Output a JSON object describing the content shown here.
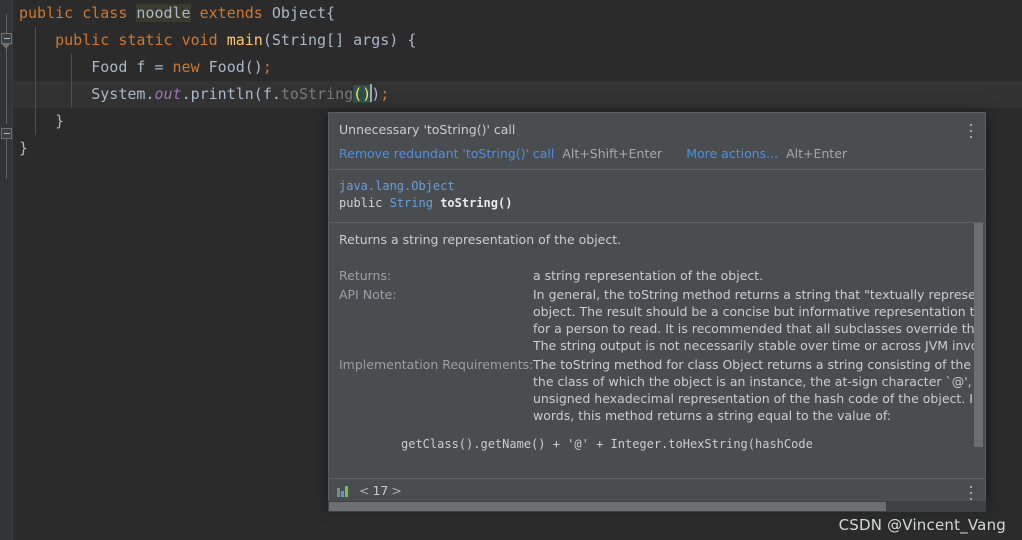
{
  "editor": {
    "lines": [
      {
        "id": "line-1",
        "tokens": [
          {
            "t": "public",
            "c": "kw"
          },
          {
            "t": " ",
            "c": "pun"
          },
          {
            "t": "class",
            "c": "kw"
          },
          {
            "t": " ",
            "c": "pun"
          },
          {
            "t": "noodle",
            "c": "hl-ident"
          },
          {
            "t": " ",
            "c": "pun"
          },
          {
            "t": "extends",
            "c": "kw"
          },
          {
            "t": " ",
            "c": "pun"
          },
          {
            "t": "Object{",
            "c": "cls"
          }
        ]
      },
      {
        "id": "line-2",
        "tokens": [
          {
            "t": "    ",
            "c": "pun"
          },
          {
            "t": "public",
            "c": "kw"
          },
          {
            "t": " ",
            "c": "pun"
          },
          {
            "t": "static",
            "c": "kw"
          },
          {
            "t": " ",
            "c": "pun"
          },
          {
            "t": "void",
            "c": "kw"
          },
          {
            "t": " ",
            "c": "pun"
          },
          {
            "t": "main",
            "c": "mth"
          },
          {
            "t": "(String[] args) {",
            "c": "cls"
          }
        ]
      },
      {
        "id": "line-3",
        "tokens": [
          {
            "t": "        ",
            "c": "pun"
          },
          {
            "t": "Food f = ",
            "c": "cls"
          },
          {
            "t": "new",
            "c": "kw"
          },
          {
            "t": " ",
            "c": "pun"
          },
          {
            "t": "Food()",
            "c": "cls"
          },
          {
            "t": ";",
            "c": "semi"
          }
        ]
      },
      {
        "id": "line-4",
        "current": true,
        "tokens": [
          {
            "t": "        ",
            "c": "pun"
          },
          {
            "t": "System.",
            "c": "cls"
          },
          {
            "t": "out",
            "c": "fld-static"
          },
          {
            "t": ".println(f.",
            "c": "cls"
          },
          {
            "t": "toString",
            "c": "greyed"
          },
          {
            "t": "()",
            "c": "sel-paren"
          },
          {
            "t": "CARET",
            "c": "caret"
          },
          {
            "t": ")",
            "c": "cls"
          },
          {
            "t": ";",
            "c": "semi"
          }
        ]
      },
      {
        "id": "line-5",
        "tokens": [
          {
            "t": "    }",
            "c": "cls"
          }
        ]
      },
      {
        "id": "line-6",
        "tokens": [
          {
            "t": "}",
            "c": "cls"
          }
        ]
      }
    ]
  },
  "popup": {
    "title": "Unnecessary 'toString()' call",
    "primary_action": "Remove redundant 'toString()' call",
    "primary_shortcut": "Alt+Shift+Enter",
    "secondary_action": "More actions...",
    "secondary_shortcut": "Alt+Enter",
    "signature": {
      "owner": "java.lang.Object",
      "modifier": "public",
      "return_type": "String",
      "name": "toString()"
    },
    "doc": {
      "summary": "Returns a string representation of the object.",
      "rows": [
        {
          "label": "Returns:",
          "lines": [
            "a string representation of the object."
          ]
        },
        {
          "label": "API Note:",
          "lines": [
            "In general, the toString method returns a string that \"textually represen",
            "object. The result should be a concise but informative representation tha",
            "for a person to read. It is recommended that all subclasses override this ",
            "The string output is not necessarily stable over time or across JVM invoc"
          ]
        },
        {
          "label": "Implementation Requirements:",
          "lines": [
            "The toString method for class Object returns a string consisting of the ",
            "the class of which the object is an instance, the at-sign character `@', and",
            "unsigned hexadecimal representation of the hash code of the object. In o",
            "words, this method returns a string equal to the value of:"
          ]
        }
      ],
      "code_sample": "getClass().getName() + '@' + Integer.toHexString(hashCode"
    },
    "footer": {
      "icon": "bar-chart-icon",
      "prev_arrow": "<",
      "version": "17",
      "next_arrow": ">"
    },
    "kebab_label": "⋮"
  },
  "watermark": "CSDN @Vincent_Vang",
  "colors": {
    "editor_bg": "#2b2b2b",
    "gutter_bg": "#313335",
    "popup_bg": "#4a4d4f",
    "link": "#4a90e2",
    "keyword": "#cc7832",
    "method": "#ffc66d",
    "static_field": "#9876aa",
    "default_text": "#a9b7c6",
    "selection": "#2f4f4a",
    "identifier_highlight": "#3b3b2d"
  }
}
